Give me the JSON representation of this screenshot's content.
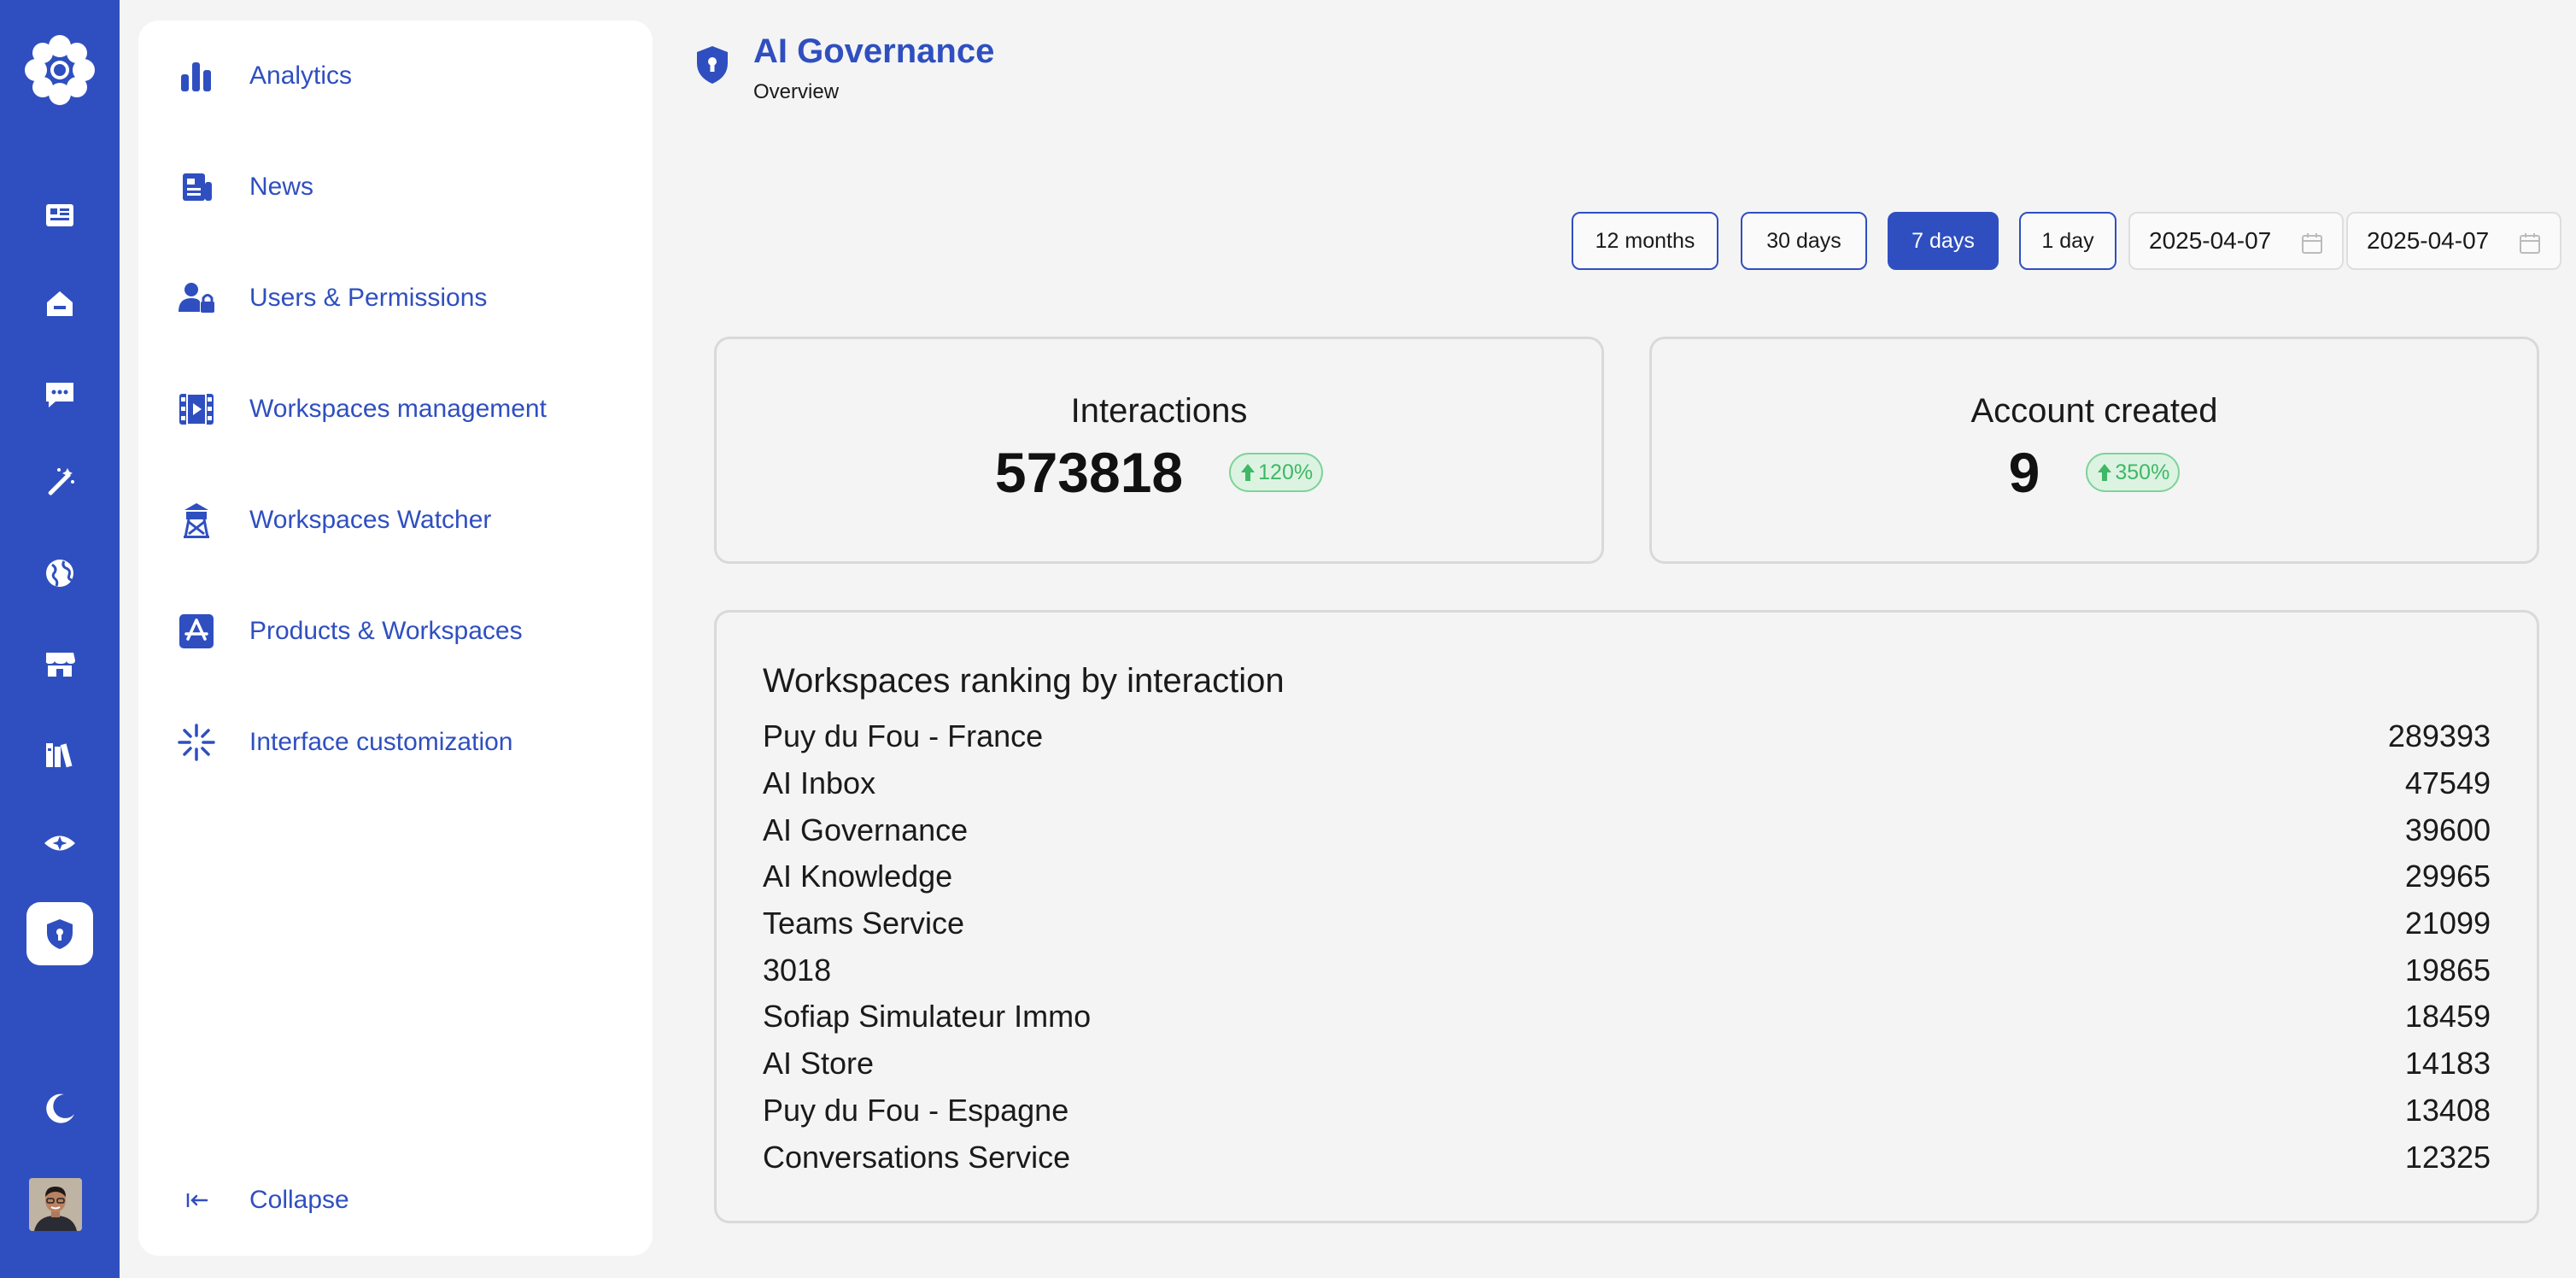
{
  "app": {
    "accent_color": "#2f4fc0"
  },
  "rail": {
    "items": [
      {
        "icon": "newspaper-icon"
      },
      {
        "icon": "home-icon"
      },
      {
        "icon": "chat-icon"
      },
      {
        "icon": "magic-wand-icon"
      },
      {
        "icon": "globe-icon"
      },
      {
        "icon": "store-icon"
      },
      {
        "icon": "library-icon"
      },
      {
        "icon": "eye-icon"
      },
      {
        "icon": "shield-icon",
        "active": true
      }
    ],
    "theme_toggle_icon": "moon-icon"
  },
  "sidebar": {
    "items": [
      {
        "label": "Analytics",
        "icon": "bar-chart-icon"
      },
      {
        "label": "News",
        "icon": "news-icon"
      },
      {
        "label": "Users & Permissions",
        "icon": "user-lock-icon"
      },
      {
        "label": "Workspaces management",
        "icon": "video-frame-icon"
      },
      {
        "label": "Workspaces Watcher",
        "icon": "watchtower-icon"
      },
      {
        "label": "Products & Workspaces",
        "icon": "app-store-icon"
      },
      {
        "label": "Interface customization",
        "icon": "sparkle-icon"
      }
    ],
    "collapse_label": "Collapse"
  },
  "header": {
    "title": "AI Governance",
    "subtitle": "Overview"
  },
  "filters": {
    "ranges": [
      "12 months",
      "30 days",
      "7 days",
      "1 day"
    ],
    "active_range": "7 days",
    "date_from": "2025-04-07",
    "date_to": "2025-04-07"
  },
  "stats": {
    "interactions": {
      "label": "Interactions",
      "value": "573818",
      "change": "120%"
    },
    "accounts": {
      "label": "Account created",
      "value": "9",
      "change": "350%"
    }
  },
  "ranking": {
    "title": "Workspaces ranking by interaction",
    "rows": [
      {
        "name": "Puy du Fou - France",
        "value": "289393"
      },
      {
        "name": "AI Inbox",
        "value": "47549"
      },
      {
        "name": "AI Governance",
        "value": "39600"
      },
      {
        "name": "AI Knowledge",
        "value": "29965"
      },
      {
        "name": "Teams Service",
        "value": "21099"
      },
      {
        "name": "3018",
        "value": "19865"
      },
      {
        "name": "Sofiap Simulateur Immo",
        "value": "18459"
      },
      {
        "name": "AI Store",
        "value": "14183"
      },
      {
        "name": "Puy du Fou - Espagne",
        "value": "13408"
      },
      {
        "name": "Conversations Service",
        "value": "12325"
      }
    ]
  }
}
